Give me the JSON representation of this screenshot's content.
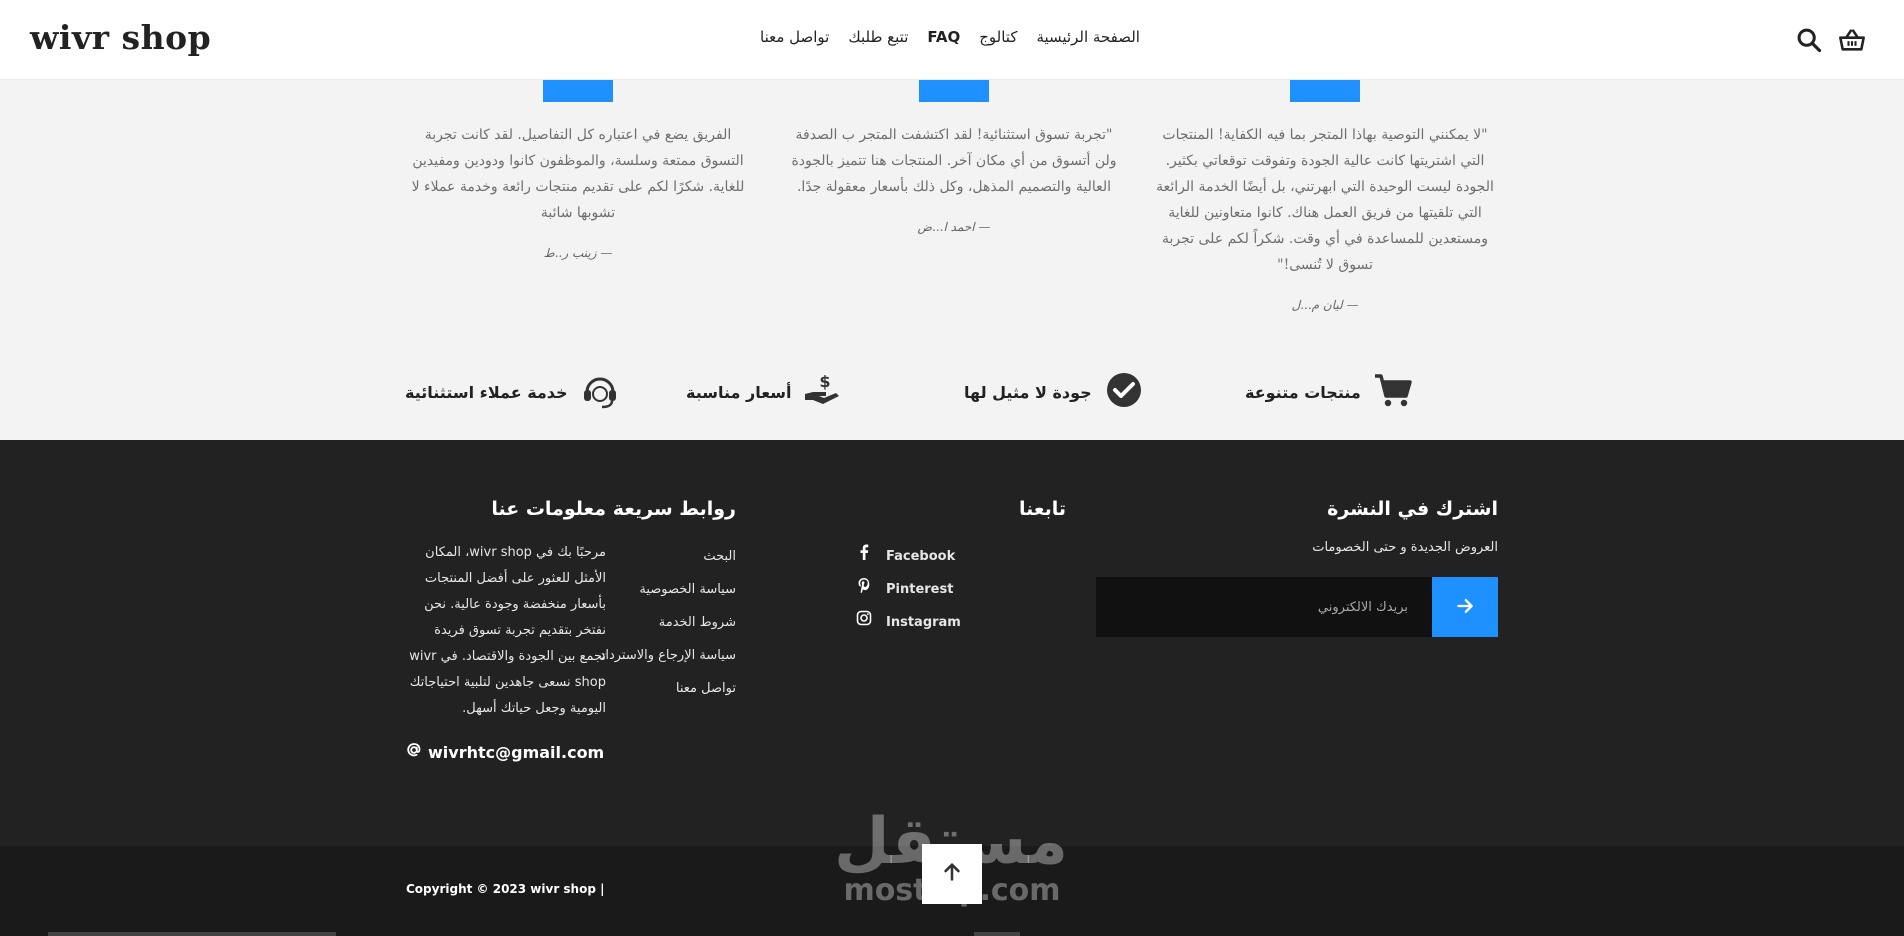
{
  "header": {
    "logo": "wivr shop",
    "nav": [
      "الصفحة الرئيسية",
      "كتالوج",
      "FAQ",
      "تتبع طلبك",
      "تواصل معنا"
    ],
    "search_icon": "search-icon",
    "cart_icon": "basket-icon"
  },
  "testimonials": [
    {
      "quote": "\"لا يمكنني التوصية بهاذا المتجر بما فيه الكفاية! المنتجات التي اشتريتها كانت عالية الجودة وتفوقت توقعاتي بكثير. الجودة ليست الوحيدة التي ابهرتني، بل أيضًا الخدمة الرائعة التي تلقيتها من فريق العمل هناك. كانوا متعاونين للغاية ومستعدين للمساعدة في أي وقت. شكراً لكم على تجربة تسوق لا تُنسى!\"",
      "author": "— ليان م...ل"
    },
    {
      "quote": "\"تجربة تسوق استثنائية! لقد اكتشفت المتجر ب الصدفة ولن أتسوق من أي مكان آخر. المنتجات هنا تتميز بالجودة العالية والتصميم المذهل، وكل ذلك بأسعار معقولة جدًا.",
      "author": "— احمد ا...ض"
    },
    {
      "quote": "الفريق يضع في اعتباره كل التفاصيل. لقد كانت تجربة التسوق ممتعة وسلسة، والموظفون كانوا ودودين ومفيدين للغاية. شكرًا لكم على تقديم منتجات رائعة وخدمة عملاء لا تشوبها شائبة",
      "author": "— زينب ر..ط"
    }
  ],
  "features": [
    {
      "label": "منتجات متنوعة",
      "icon": "cart-icon"
    },
    {
      "label": "جودة لا مثيل لها",
      "icon": "check-circle-icon"
    },
    {
      "label": "أسعار مناسبة",
      "icon": "hand-dollar-icon"
    },
    {
      "label": "خدمة عملاء استثنائية",
      "icon": "headset-icon"
    }
  ],
  "footer": {
    "about": {
      "title": "معلومات عنا",
      "text": "مرحبًا بك في wivr shop، المكان الأمثل للعثور على أفضل المنتجات بأسعار منخفضة وجودة عالية. نحن نفتخر بتقديم تجربة تسوق فريدة تجمع بين الجودة والاقتصاد. في wivr shop نسعى جاهدين لتلبية احتياجاتك اليومية وجعل حياتك أسهل.",
      "email": "wivrhtc@gmail.com",
      "email_icon": "at-icon"
    },
    "links": {
      "title": "روابط سريعة",
      "items": [
        "البحث",
        "سياسة الخصوصية",
        "شروط الخدمة",
        "سياسة الإرجاع والاسترداد",
        "تواصل معنا"
      ]
    },
    "follow": {
      "title": "تابعنا",
      "items": [
        {
          "label": "Facebook",
          "icon": "facebook-icon"
        },
        {
          "label": "Pinterest",
          "icon": "pinterest-icon"
        },
        {
          "label": "Instagram",
          "icon": "instagram-icon"
        }
      ]
    },
    "newsletter": {
      "title": "اشترك في النشرة",
      "text": "العروض الجديدة و حتى الخصومات",
      "placeholder": "بريدك الالكتروني",
      "submit_icon": "arrow-right-icon"
    }
  },
  "bottom": {
    "copyright": "Copyright © 2023 wivr shop |",
    "to_top_icon": "arrow-up-icon",
    "watermark_ar": "مستقل",
    "watermark_en": "mostaql.com"
  },
  "colors": {
    "accent": "#1e90ff",
    "footer_bg": "#222222",
    "bottom_bg": "#1a1a1a"
  }
}
